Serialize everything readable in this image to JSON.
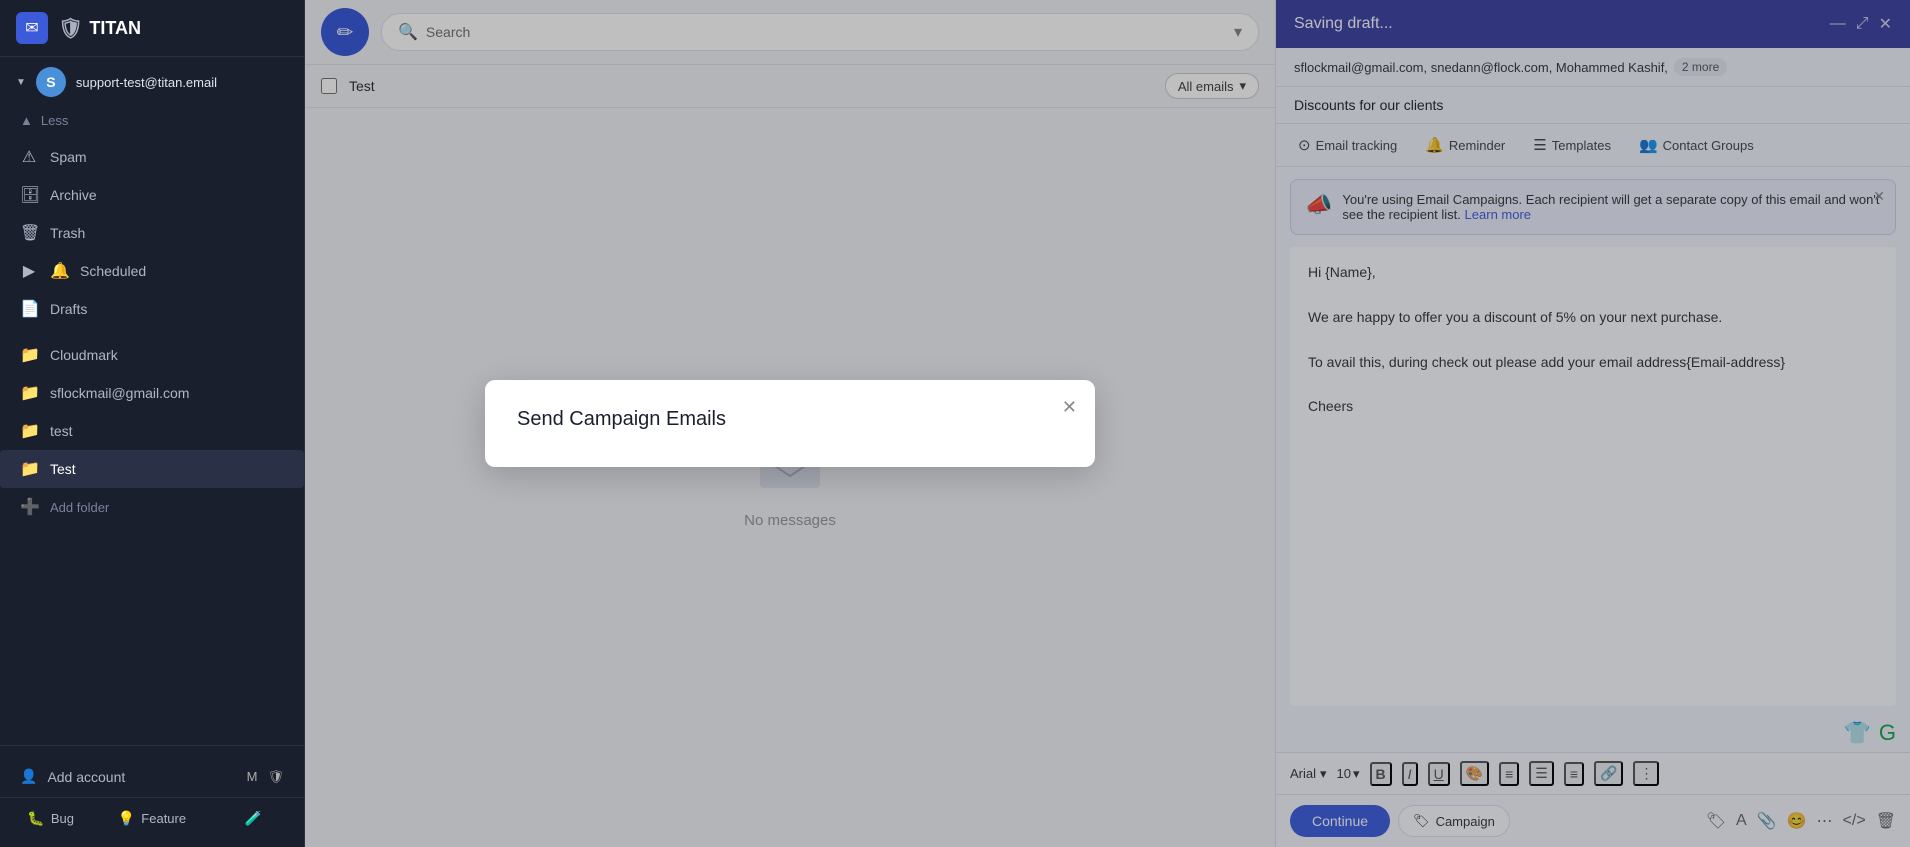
{
  "app": {
    "title": "TITAN",
    "logo_icon": "🛡",
    "email_icon": "✉"
  },
  "sidebar": {
    "account": {
      "email": "support-test@titan.email",
      "avatar_letter": "S"
    },
    "less_label": "Less",
    "items": [
      {
        "id": "spam",
        "icon": "⚠",
        "label": "Spam"
      },
      {
        "id": "archive",
        "icon": "🗄",
        "label": "Archive"
      },
      {
        "id": "trash",
        "icon": "🗑",
        "label": "Trash"
      },
      {
        "id": "scheduled",
        "icon": "🔔",
        "label": "Scheduled",
        "has_arrow": true
      },
      {
        "id": "drafts",
        "icon": "📄",
        "label": "Drafts"
      },
      {
        "id": "cloudmark",
        "icon": "📁",
        "label": "Cloudmark"
      },
      {
        "id": "sflockmail",
        "icon": "📁",
        "label": "sflockmail@gmail.com"
      },
      {
        "id": "testfolder",
        "icon": "📁",
        "label": "test"
      },
      {
        "id": "testfolder2",
        "icon": "📁",
        "label": "Test",
        "active": true
      }
    ],
    "add_folder_label": "Add folder",
    "add_account_label": "Add account",
    "footer_tabs": [
      {
        "id": "bug",
        "icon": "🐛",
        "label": "Bug"
      },
      {
        "id": "feature",
        "icon": "💡",
        "label": "Feature"
      },
      {
        "id": "flask",
        "icon": "🧪",
        "label": ""
      }
    ],
    "footer_icons": [
      "M",
      "🛡"
    ]
  },
  "search": {
    "placeholder": "Search",
    "filter_icon": "▾"
  },
  "email_list": {
    "filter_label": "Test",
    "all_emails_label": "All emails",
    "no_messages": "No messages"
  },
  "compose": {
    "header_title": "Saving draft...",
    "recipients": "sflockmail@gmail.com, snedann@flock.com, Mohammed Kashif,",
    "more_label": "2 more",
    "subject": "Discounts for our clients",
    "features": [
      {
        "id": "email-tracking",
        "icon": "⊙",
        "label": "Email tracking"
      },
      {
        "id": "reminder",
        "icon": "🔔",
        "label": "Reminder"
      },
      {
        "id": "templates",
        "icon": "☰",
        "label": "Templates"
      },
      {
        "id": "contact-groups",
        "icon": "👥",
        "label": "Contact Groups"
      }
    ],
    "campaign_notice": "You're using Email Campaigns. Each recipient will get a separate copy of this email and won't see the recipient list.",
    "learn_more": "Learn more",
    "body_line1": "Hi {Name},",
    "body_line2": "",
    "body_line3": "We are happy to offer you a discount of 5% on your next purchase.",
    "body_line4": "",
    "body_line5": "To avail this, during check out please add your email address{Email-address}",
    "body_line6": "",
    "body_line7": "Cheers",
    "font": "Arial",
    "font_size": "10",
    "continue_label": "Continue",
    "campaign_label": "Campaign",
    "format_buttons": [
      "B",
      "I",
      "U",
      "🎨",
      "≡",
      "≡",
      "≡",
      "🔗",
      "⋮"
    ]
  },
  "modal": {
    "title": "Send Campaign Emails",
    "close_icon": "✕"
  }
}
